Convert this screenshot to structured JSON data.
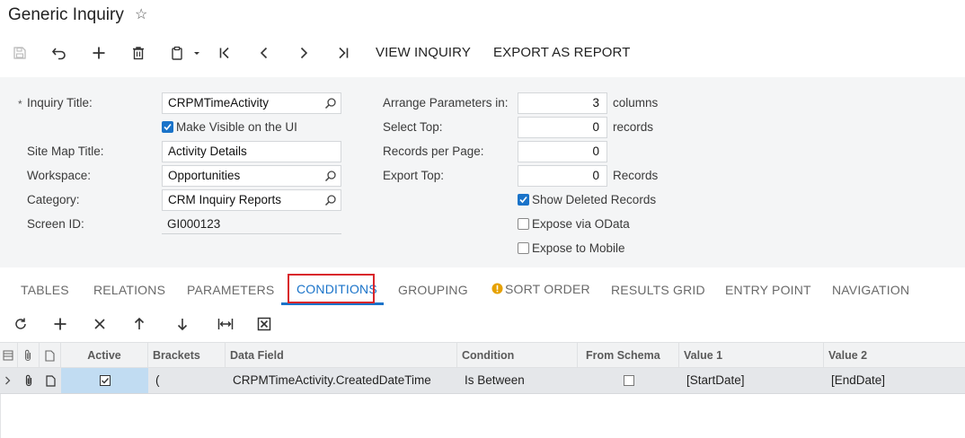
{
  "header": {
    "title": "Generic Inquiry"
  },
  "toolbar": {
    "view_inquiry": "VIEW INQUIRY",
    "export_as_report": "EXPORT AS REPORT"
  },
  "form": {
    "required_mark": "*",
    "inquiry_title_label": "Inquiry Title:",
    "inquiry_title_value": "CRPMTimeActivity",
    "make_visible_label": "Make Visible on the UI",
    "make_visible_checked": true,
    "site_map_title_label": "Site Map Title:",
    "site_map_title_value": "Activity Details",
    "workspace_label": "Workspace:",
    "workspace_value": "Opportunities",
    "category_label": "Category:",
    "category_value": "CRM Inquiry Reports",
    "screen_id_label": "Screen ID:",
    "screen_id_value": "GI000123",
    "arrange_label": "Arrange Parameters in:",
    "arrange_value": "3",
    "arrange_unit": "columns",
    "select_top_label": "Select Top:",
    "select_top_value": "0",
    "select_top_unit": "records",
    "records_per_page_label": "Records per Page:",
    "records_per_page_value": "0",
    "export_top_label": "Export Top:",
    "export_top_value": "0",
    "export_top_unit": "Records",
    "show_deleted_label": "Show Deleted Records",
    "show_deleted_checked": true,
    "expose_odata_label": "Expose via OData",
    "expose_odata_checked": false,
    "expose_mobile_label": "Expose to Mobile",
    "expose_mobile_checked": false
  },
  "tabs": [
    {
      "label": "TABLES"
    },
    {
      "label": "RELATIONS"
    },
    {
      "label": "PARAMETERS"
    },
    {
      "label": "CONDITIONS",
      "active": true
    },
    {
      "label": "GROUPING"
    },
    {
      "label": "SORT ORDER",
      "warning": true
    },
    {
      "label": "RESULTS GRID"
    },
    {
      "label": "ENTRY POINT"
    },
    {
      "label": "NAVIGATION"
    }
  ],
  "grid": {
    "columns": {
      "active": "Active",
      "brackets": "Brackets",
      "data_field": "Data Field",
      "condition": "Condition",
      "from_schema": "From Schema",
      "value1": "Value 1",
      "value2": "Value 2"
    },
    "rows": [
      {
        "active": true,
        "brackets": "(",
        "data_field": "CRPMTimeActivity.CreatedDateTime",
        "condition": "Is Between",
        "from_schema": false,
        "value1": "[StartDate]",
        "value2": "[EndDate]"
      }
    ]
  },
  "colors": {
    "accent": "#1a73c9",
    "highlight_box": "#d9262b",
    "warning": "#e6a100"
  }
}
